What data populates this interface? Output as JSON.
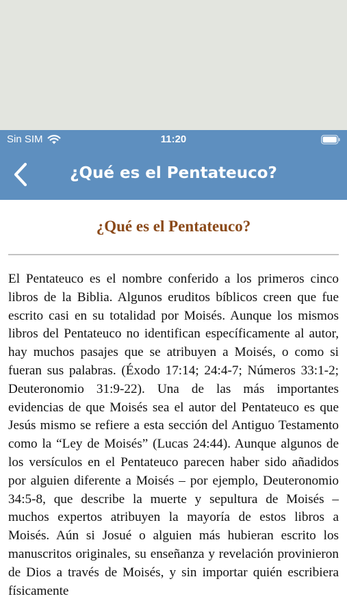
{
  "status_bar": {
    "carrier": "Sin SIM",
    "time": "11:20",
    "wifi_icon": "wifi-icon",
    "battery_icon": "battery-icon"
  },
  "nav": {
    "title": "¿Qué es el Pentateuco?",
    "back_icon": "chevron-left-icon",
    "background_color": "#5e8fbf"
  },
  "article": {
    "title": "¿Qué es el Pentateuco?",
    "title_color": "#8b4a1a",
    "body": "El Pentateuco es el nombre conferido a los primeros cinco libros de la Biblia. Algunos eruditos bíblicos creen que fue escrito casi en su totalidad por Moisés. Aunque los mismos libros del Pentateuco no identifican específicamente al autor, hay muchos pasajes que se atribuyen a Moisés, o como si fueran sus palabras. (Éxodo 17:14; 24:4-7; Números 33:1-2; Deuteronomio 31:9-22). Una de las más importantes evidencias de que Moisés sea el autor del Pentateuco es que Jesús mismo se refiere a esta sección del Antiguo Testamento como la “Ley de Moisés” (Lucas 24:44). Aunque algunos de los versículos en el Pentateuco parecen haber sido añadidos por alguien diferente a Moisés – por ejemplo, Deuteronomio 34:5-8, que describe la muerte y sepultura de Moisés – muchos expertos atribuyen la mayoría de estos libros a Moisés. Aún si Josué o alguien más hubieran escrito los manuscritos originales, su enseñanza y revelación provinieron de Dios a través de Moisés, y sin importar quién escribiera físicamente"
  }
}
